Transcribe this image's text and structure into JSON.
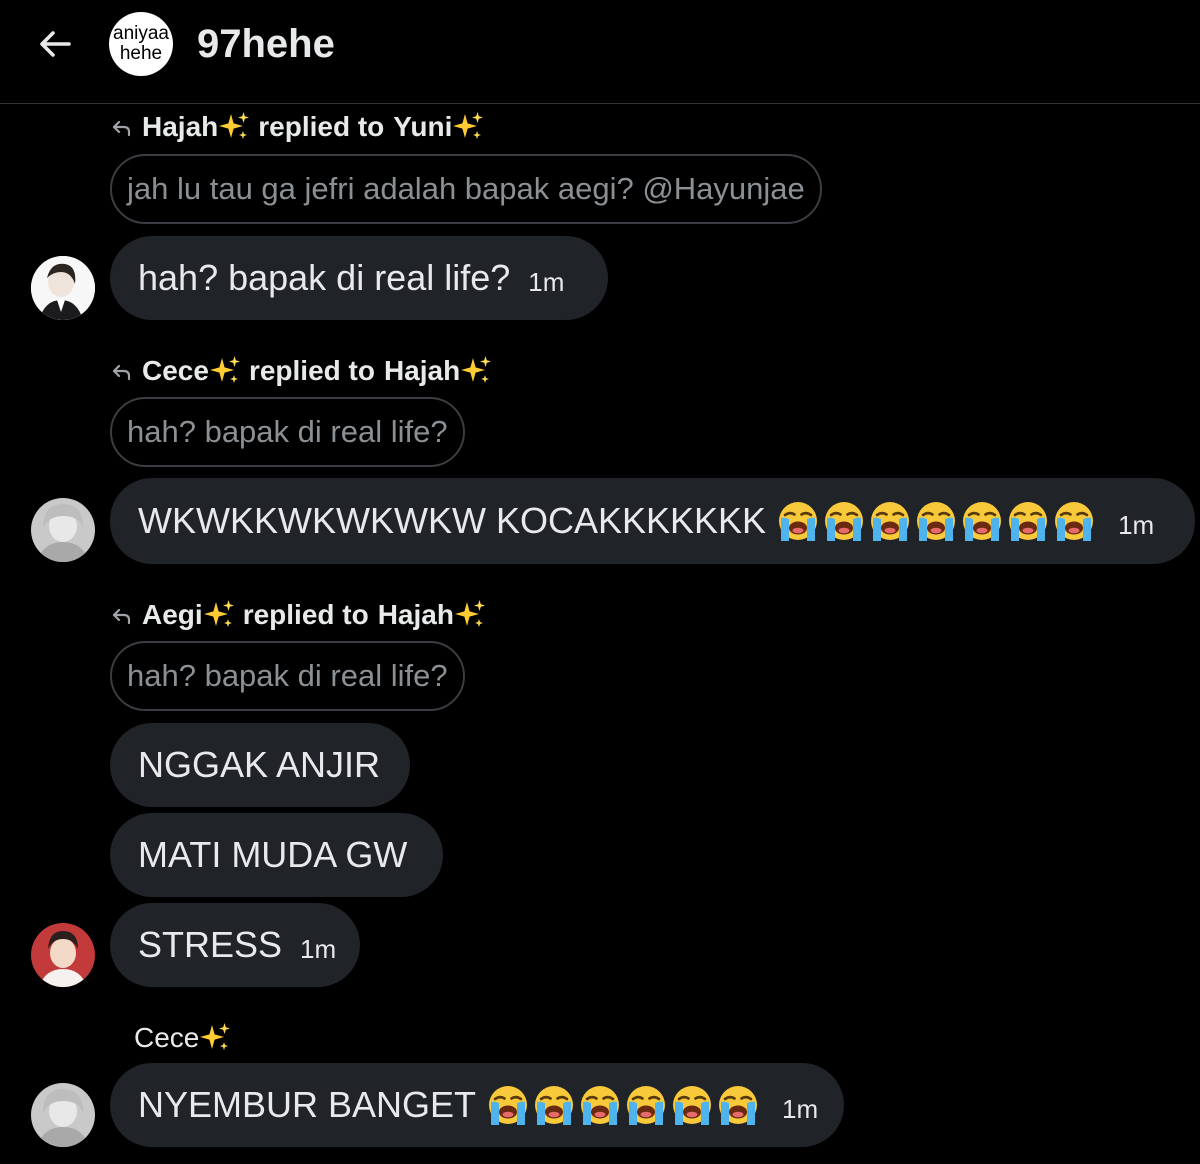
{
  "header": {
    "group_avatar_line1": "aniyaa",
    "group_avatar_line2": "hehe",
    "title": "97hehe"
  },
  "messages": [
    {
      "reply_sender": "Hajah",
      "reply_verb": "replied to",
      "reply_target": "Yuni",
      "quoted_text": "jah lu tau ga jefri adalah bapak aegi? @Hayunjae",
      "bubbles": [
        {
          "text": "hah? bapak di real life?",
          "time": "1m"
        }
      ]
    },
    {
      "reply_sender": "Cece",
      "reply_verb": "replied to",
      "reply_target": "Hajah",
      "quoted_text": "hah? bapak di real life?",
      "bubbles": [
        {
          "text": "WKWKKWKWKWKW KOCAKKKKKKK",
          "emoji": "loudly-crying-face",
          "emoji_count": 7,
          "time": "1m"
        }
      ]
    },
    {
      "reply_sender": "Aegi",
      "reply_verb": "replied to",
      "reply_target": "Hajah",
      "quoted_text": "hah? bapak di real life?",
      "bubbles": [
        {
          "text": "NGGAK ANJIR"
        },
        {
          "text": "MATI MUDA GW"
        },
        {
          "text": "STRESS",
          "time": "1m"
        }
      ]
    },
    {
      "sender": "Cece",
      "bubbles": [
        {
          "text": "NYEMBUR BANGET",
          "emoji": "loudly-crying-face",
          "emoji_count": 6,
          "time": "1m"
        }
      ]
    }
  ],
  "colors": {
    "background": "#000000",
    "bubble": "#202327",
    "text": "#e7e9ea",
    "quote_text": "#8b9095",
    "quote_border": "#3a3d41",
    "divider": "#2f3336"
  },
  "icons": [
    "back-arrow-icon",
    "reply-arrow-icon",
    "sparkles-emoji",
    "loudly-crying-face-emoji"
  ]
}
